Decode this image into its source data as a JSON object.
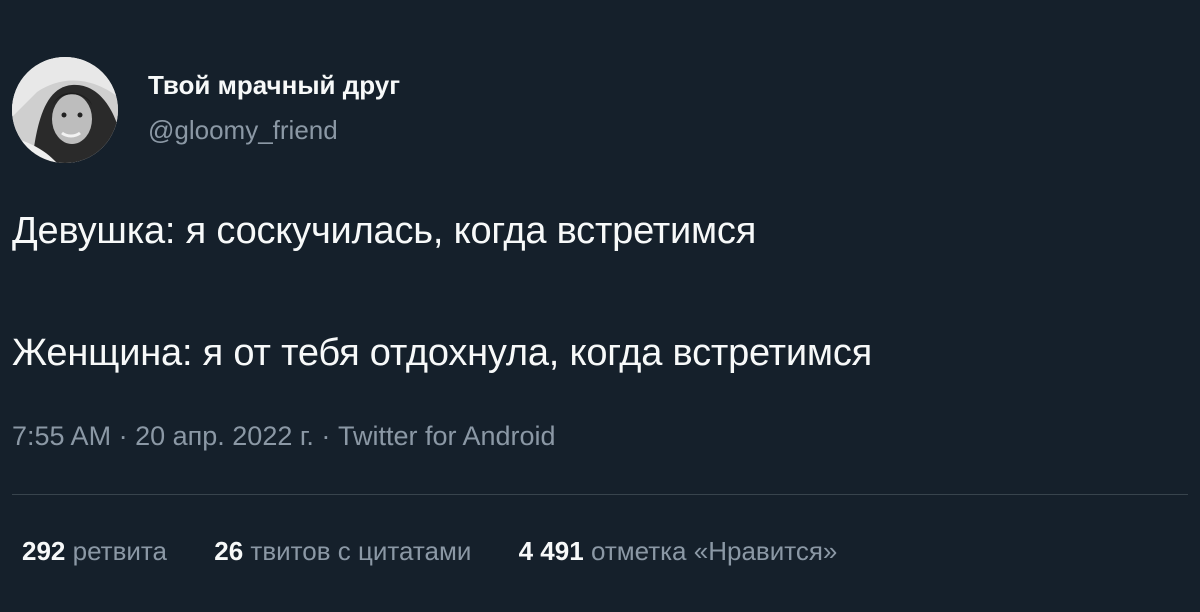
{
  "author": {
    "display_name": "Твой мрачный друг",
    "handle": "@gloomy_friend",
    "avatar_icon": "avatar-photo"
  },
  "tweet": {
    "lines": [
      "Девушка: я соскучилась, когда встретимся",
      "Женщина: я от тебя отдохнула, когда встретимся"
    ]
  },
  "meta": {
    "time": "7:55 AM",
    "separator": "·",
    "date": "20 апр. 2022 г.",
    "source": "Twitter for Android"
  },
  "stats": [
    {
      "count": "292",
      "label": "ретвита"
    },
    {
      "count": "26",
      "label": "твитов с цитатами"
    },
    {
      "count": "4 491",
      "label": "отметка «Нравится»"
    }
  ],
  "colors": {
    "background": "#15202b",
    "primary_text": "#f7f9f9",
    "secondary_text": "#8b98a5",
    "divider": "#38444d"
  }
}
